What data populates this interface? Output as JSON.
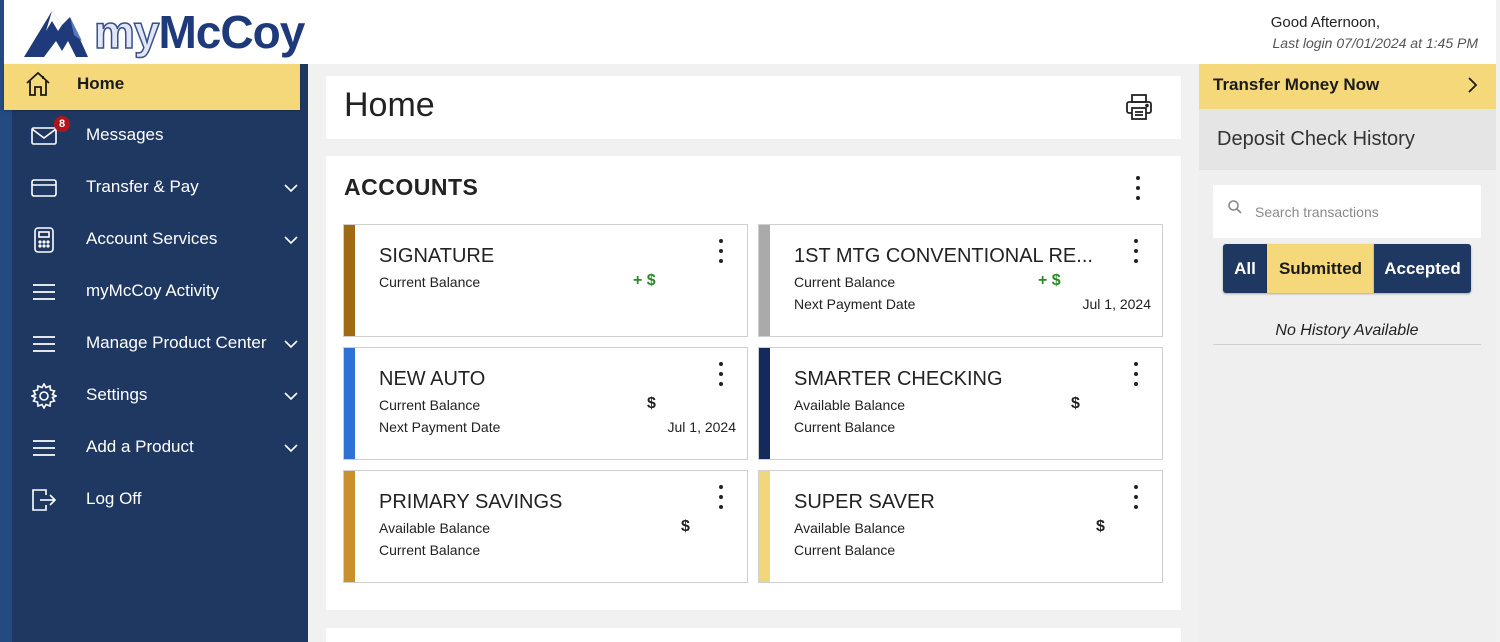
{
  "header": {
    "logo_my": "my",
    "logo_mccoy": "McCoy",
    "greeting": "Good Afternoon,",
    "last_login": "Last login 07/01/2024 at 1:45 PM"
  },
  "sidebar": {
    "items": [
      {
        "label": "Home",
        "icon": "home-icon",
        "active": true
      },
      {
        "label": "Messages",
        "icon": "mail-icon",
        "badge": "8"
      },
      {
        "label": "Transfer & Pay",
        "icon": "card-icon",
        "has_chevron": true
      },
      {
        "label": "Account Services",
        "icon": "calculator-icon",
        "has_chevron": true
      },
      {
        "label": "myMcCoy Activity",
        "icon": "menu-icon"
      },
      {
        "label": "Manage Product Center",
        "icon": "menu-icon",
        "has_chevron": true
      },
      {
        "label": "Settings",
        "icon": "gear-icon",
        "has_chevron": true
      },
      {
        "label": "Add a Product",
        "icon": "menu-icon",
        "has_chevron": true
      },
      {
        "label": "Log Off",
        "icon": "logout-icon"
      }
    ]
  },
  "main": {
    "page_title": "Home",
    "accounts_title": "ACCOUNTS",
    "accounts": [
      {
        "name": "SIGNATURE",
        "row1": "Current Balance",
        "row1_amount": "+ $",
        "row2": "",
        "row2_value": "",
        "stripe": "#a06a14",
        "amount_color": "green"
      },
      {
        "name": "1ST MTG CONVENTIONAL RE...",
        "row1": "Current Balance",
        "row1_amount": "+ $",
        "row2": "Next Payment Date",
        "row2_value": "Jul 1, 2024",
        "stripe": "#aaaaaa",
        "amount_color": "green"
      },
      {
        "name": "NEW AUTO",
        "row1": "Current Balance",
        "row1_amount": "$",
        "row2": "Next Payment Date",
        "row2_value": "Jul 1, 2024",
        "stripe": "#2f72d6",
        "amount_color": "black"
      },
      {
        "name": "SMARTER CHECKING",
        "row1": "Available Balance",
        "row1_amount": "$",
        "row2": "Current Balance",
        "row2_value": "",
        "stripe": "#14295c",
        "amount_color": "black"
      },
      {
        "name": "PRIMARY SAVINGS",
        "row1": "Available Balance",
        "row1_amount": "$",
        "row2": "Current Balance",
        "row2_value": "",
        "stripe": "#c9902c",
        "amount_color": "black"
      },
      {
        "name": "SUPER SAVER",
        "row1": "Available Balance",
        "row1_amount": "$",
        "row2": "Current Balance",
        "row2_value": "",
        "stripe": "#f2d67a",
        "amount_color": "black"
      }
    ]
  },
  "right": {
    "transfer_label": "Transfer Money Now",
    "deposit_title": "Deposit Check History",
    "search_placeholder": "Search transactions",
    "filters": [
      "All",
      "Submitted",
      "Accepted"
    ],
    "selected_filter": "Submitted",
    "empty_text": "No History Available"
  },
  "colors": {
    "navy": "#1f3862",
    "gold": "#f4d879",
    "green": "#2a8a2a",
    "badge_red": "#b3141a"
  }
}
